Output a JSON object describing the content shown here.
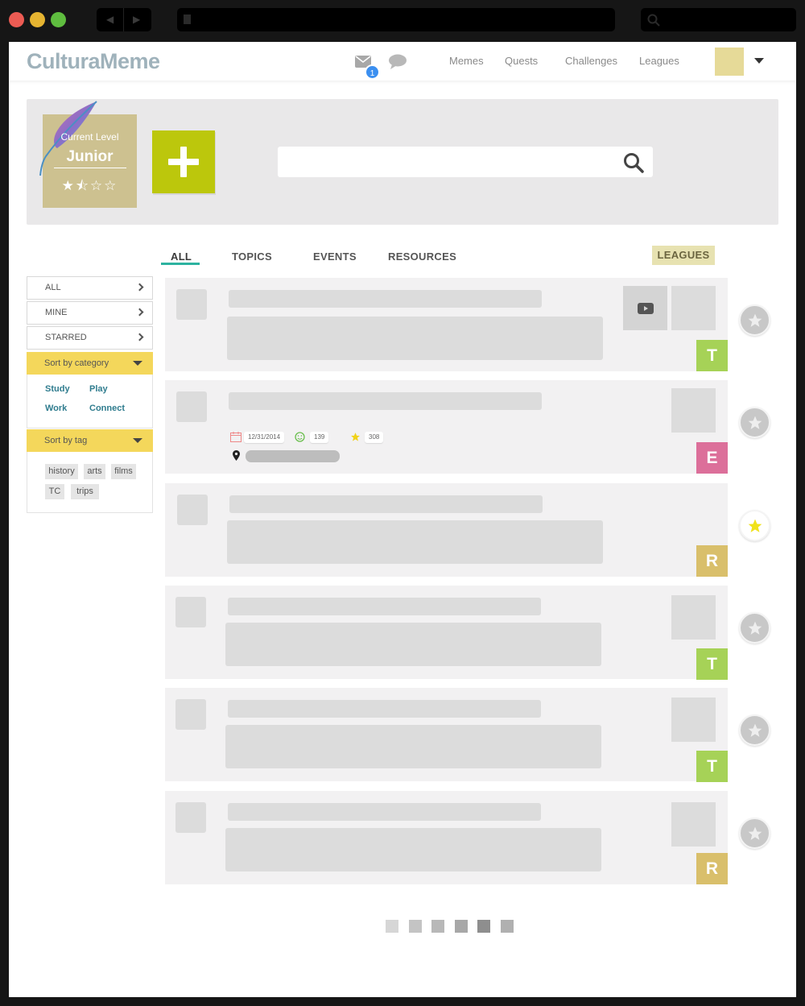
{
  "app": {
    "logo": "CulturaMeme",
    "mail_count": "1",
    "nav": [
      "Memes",
      "Quests",
      "Challenges",
      "Leagues"
    ]
  },
  "level": {
    "caption": "Current Level",
    "name": "Junior",
    "stars": "★⯪☆☆",
    "rating": 1.5,
    "rating_max": 4
  },
  "search": {
    "placeholder": ""
  },
  "tabs": {
    "items": [
      "ALL",
      "TOPICS",
      "EVENTS",
      "RESOURCES"
    ],
    "active": "ALL",
    "leagues": "LEAGUES"
  },
  "sidebar": {
    "filters": [
      "ALL",
      "MINE",
      "STARRED"
    ],
    "sort_category": "Sort by category",
    "categories": [
      "Study",
      "Play",
      "Work",
      "Connect"
    ],
    "sort_tag": "Sort by tag",
    "tags": [
      "history",
      "arts",
      "films",
      "TC",
      "trips"
    ]
  },
  "cards": [
    {
      "type": "T",
      "color": "#a6d257",
      "starred": false,
      "media": "video"
    },
    {
      "type": "E",
      "color": "#dc6f9a",
      "starred": false,
      "date": "12/31/2014",
      "likes": "139",
      "stars": "308"
    },
    {
      "type": "R",
      "color": "#d9bf6b",
      "starred": true
    },
    {
      "type": "T",
      "color": "#a6d257",
      "starred": false
    },
    {
      "type": "T",
      "color": "#a6d257",
      "starred": false
    },
    {
      "type": "R",
      "color": "#d9bf6b",
      "starred": false
    }
  ],
  "colors": {
    "accent_green": "#bcc70c",
    "accent_yellow": "#f4d75b",
    "tab_underline": "#2db3a0",
    "star_yellow": "#f0e21a"
  },
  "pager": {
    "pages": 6,
    "current": 5
  }
}
